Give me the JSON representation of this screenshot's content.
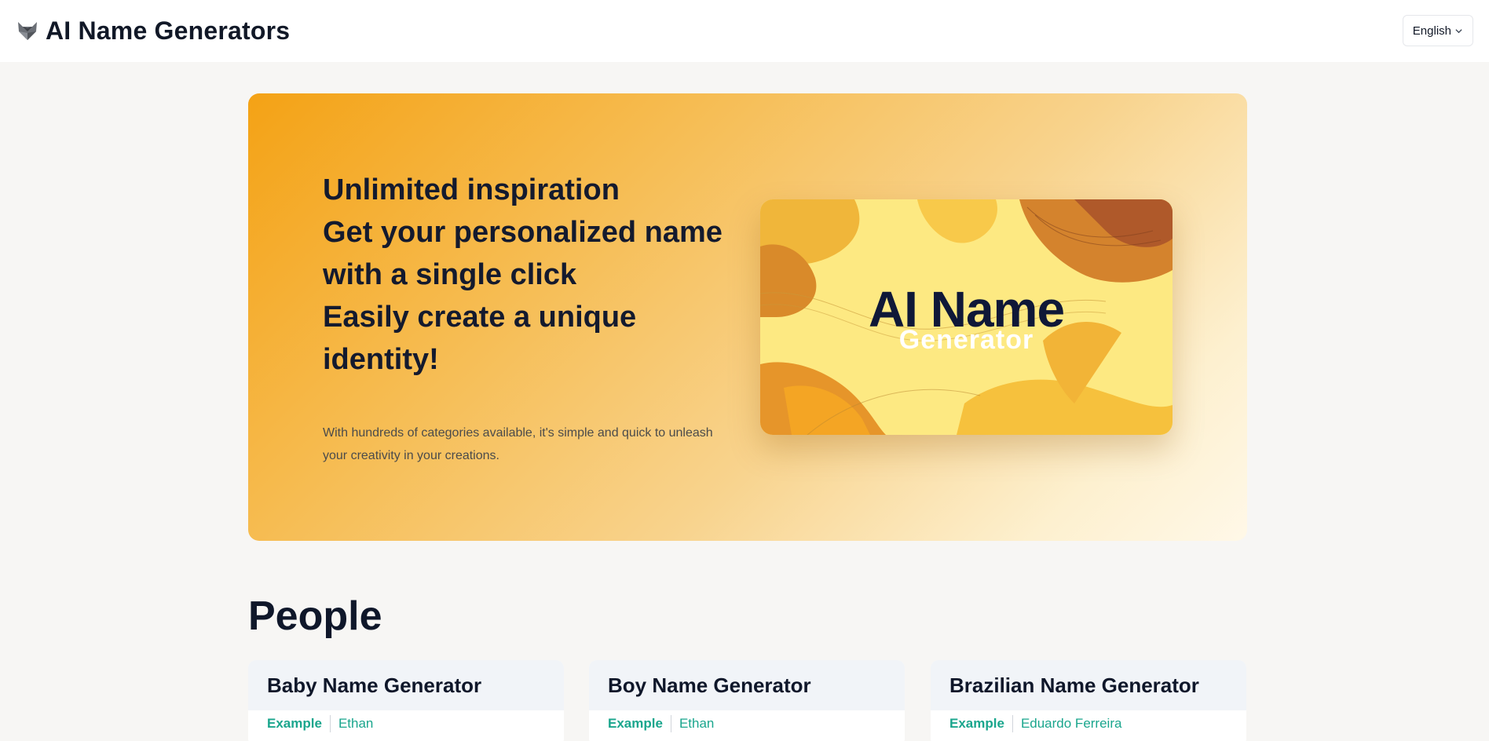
{
  "header": {
    "site_title": "AI Name Generators",
    "logo_icon": "wolf-logo-icon",
    "language": "English",
    "language_icon": "chevron-down-icon"
  },
  "hero": {
    "headline_lines": [
      "Unlimited inspiration",
      "Get your personalized name",
      "with a single click",
      "Easily create a unique",
      "identity!"
    ],
    "subtext": "With hundreds of categories available, it's simple and quick to unleash your creativity in your creations.",
    "card_title": "AI Name",
    "card_subtitle": "Generator",
    "gradient_colors": [
      "#f4a215",
      "#fff8e8"
    ]
  },
  "section": {
    "title": "People",
    "cards": [
      {
        "title": "Baby Name Generator",
        "example_label": "Example",
        "example_value": "Ethan"
      },
      {
        "title": "Boy Name Generator",
        "example_label": "Example",
        "example_value": "Ethan"
      },
      {
        "title": "Brazilian Name Generator",
        "example_label": "Example",
        "example_value": "Eduardo Ferreira"
      }
    ]
  },
  "colors": {
    "accent_teal": "#1aa68d",
    "text_dark": "#0f172a",
    "page_bg": "#f7f6f4"
  }
}
